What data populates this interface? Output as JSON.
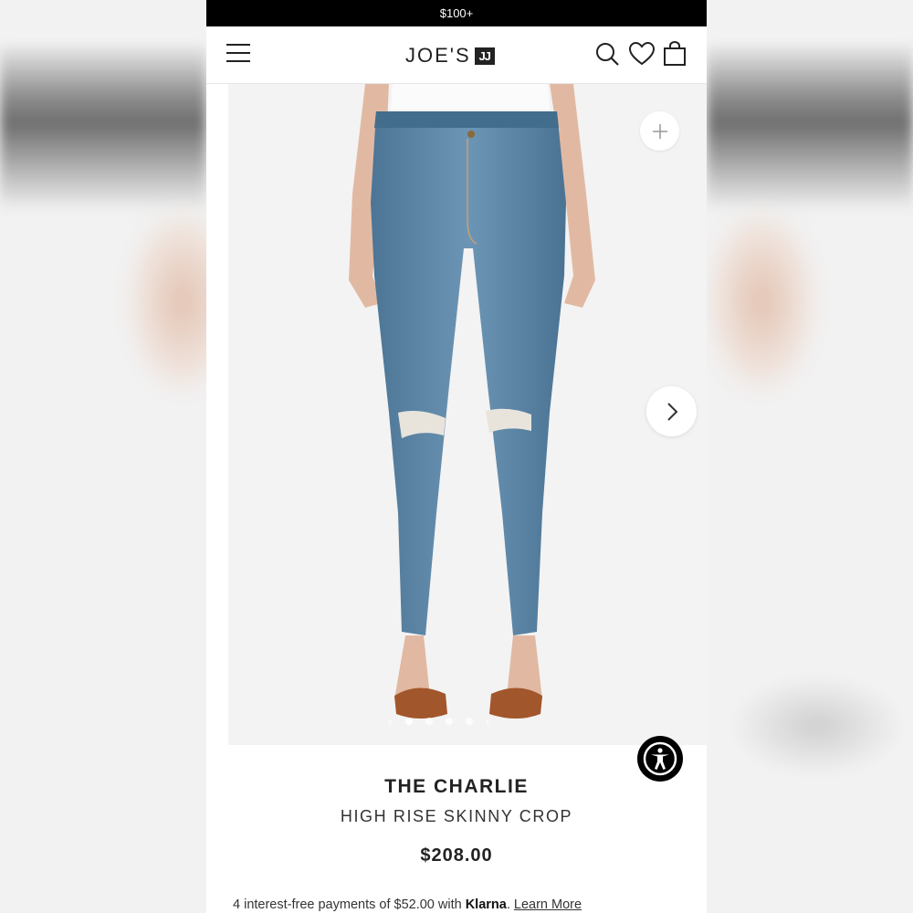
{
  "promo": {
    "text": "$100+"
  },
  "header": {
    "logo_text": "JOE'S",
    "logo_mark": "JJ"
  },
  "icons": {
    "menu": "menu-icon",
    "search": "search-icon",
    "wishlist": "heart-icon",
    "bag": "shopping-bag-icon",
    "zoom": "plus-icon",
    "next": "chevron-right-icon",
    "accessibility": "accessibility-icon"
  },
  "gallery": {
    "slides": 4,
    "active_slide": 1
  },
  "product": {
    "name": "THE CHARLIE",
    "style": "HIGH RISE SKINNY CROP",
    "price": "$208.00"
  },
  "klarna": {
    "prefix": "4 interest-free payments of $52.00 with ",
    "brand": "Klarna",
    "suffix": ". ",
    "link": "Learn More"
  },
  "colors": {
    "promo_bg": "#000000",
    "denim": "#5b85a6",
    "sandal": "#a2562b"
  }
}
